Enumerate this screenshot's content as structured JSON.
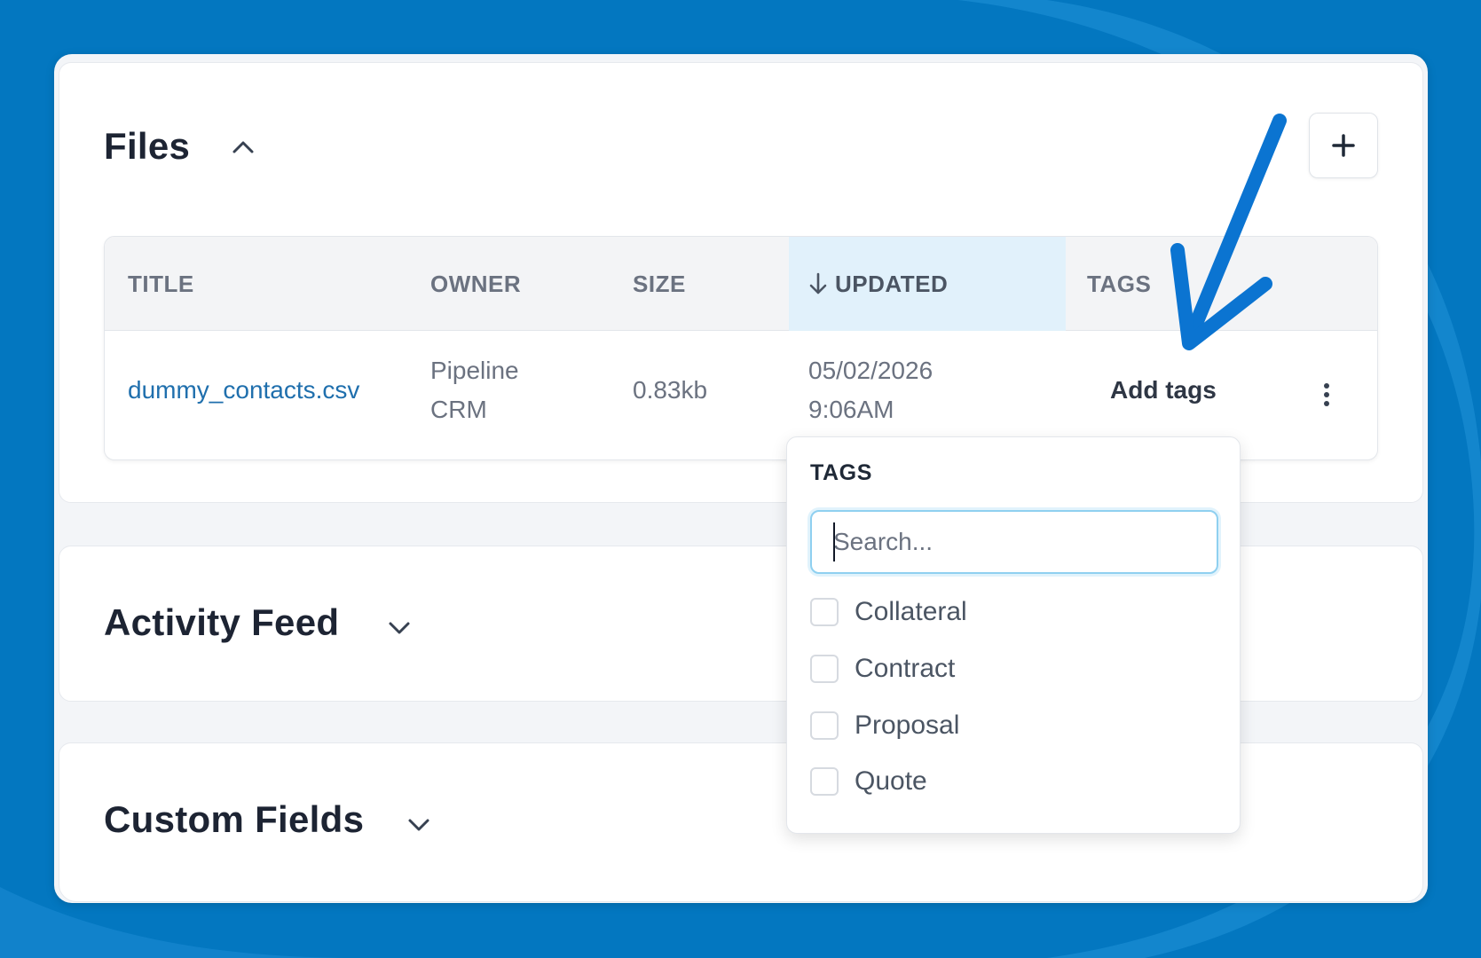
{
  "colors": {
    "background": "#0377c0",
    "link": "#1f6fad",
    "arrow": "#0b74d1",
    "sorted_header": "#e1f1fb"
  },
  "files": {
    "title": "Files",
    "expanded": true,
    "add_icon": "plus-icon",
    "table": {
      "columns": [
        "TITLE",
        "OWNER",
        "SIZE",
        "UPDATED",
        "TAGS"
      ],
      "sorted_column": "UPDATED",
      "sort_direction": "descending",
      "rows": [
        {
          "title": "dummy_contacts.csv",
          "owner_line1": "Pipeline",
          "owner_line2": "CRM",
          "size": "0.83kb",
          "updated_date": "05/02/2026",
          "updated_time": "9:06AM",
          "tags_action": "Add tags"
        }
      ]
    }
  },
  "tags_dropdown": {
    "title": "TAGS",
    "search_placeholder": "Search...",
    "options": [
      "Collateral",
      "Contract",
      "Proposal",
      "Quote"
    ]
  },
  "activity_feed": {
    "title": "Activity Feed",
    "expanded": false
  },
  "custom_fields": {
    "title": "Custom Fields",
    "expanded": false
  }
}
